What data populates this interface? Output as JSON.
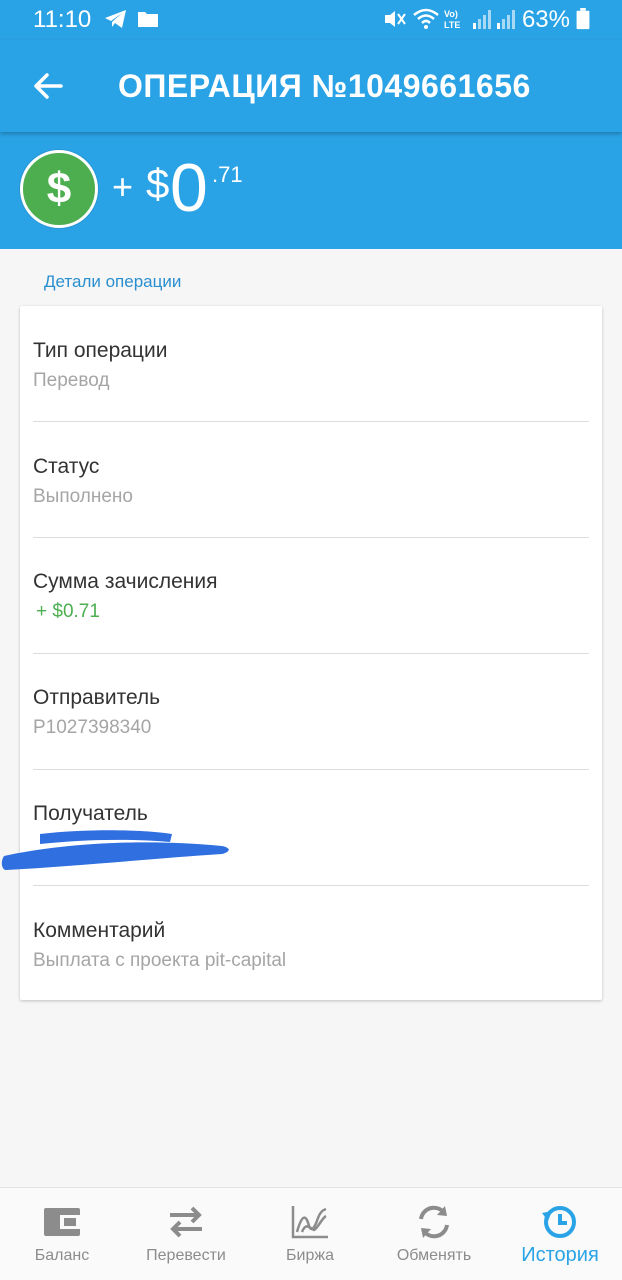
{
  "status_bar": {
    "time": "11:10",
    "battery": "63%",
    "icons": [
      "telegram-icon",
      "folder-icon",
      "mute-icon",
      "wifi-icon",
      "volte-icon",
      "signal-icon",
      "signal-icon",
      "battery-icon"
    ]
  },
  "app_bar": {
    "title": "ОПЕРАЦИЯ №1049661656",
    "back_icon": "arrow-left-icon"
  },
  "amount": {
    "sign": "+",
    "currency": "$",
    "integer": "0",
    "cents": ".71",
    "coin_icon": "dollar-coin-icon"
  },
  "section_label": "Детали операции",
  "details": [
    {
      "label": "Тип операции",
      "value": "Перевод"
    },
    {
      "label": "Статус",
      "value": "Выполнено"
    },
    {
      "label": "Сумма зачисления",
      "value": "+ $0.71"
    },
    {
      "label": "Отправитель",
      "value": "P1027398340"
    },
    {
      "label": "Получатель",
      "value": ""
    },
    {
      "label": "Комментарий",
      "value": "Выплата с проекта pit-capital"
    }
  ],
  "bottom_nav": [
    {
      "label": "Баланс",
      "icon": "wallet-icon",
      "active": false
    },
    {
      "label": "Перевести",
      "icon": "transfer-arrows-icon",
      "active": false
    },
    {
      "label": "Биржа",
      "icon": "chart-icon",
      "active": false
    },
    {
      "label": "Обменять",
      "icon": "exchange-refresh-icon",
      "active": false
    },
    {
      "label": "История",
      "icon": "history-icon",
      "active": true
    }
  ],
  "colors": {
    "primary": "#2aa3e6",
    "positive": "#4caf50",
    "coin": "#4cae4f",
    "scribble": "#2f6fe0"
  }
}
